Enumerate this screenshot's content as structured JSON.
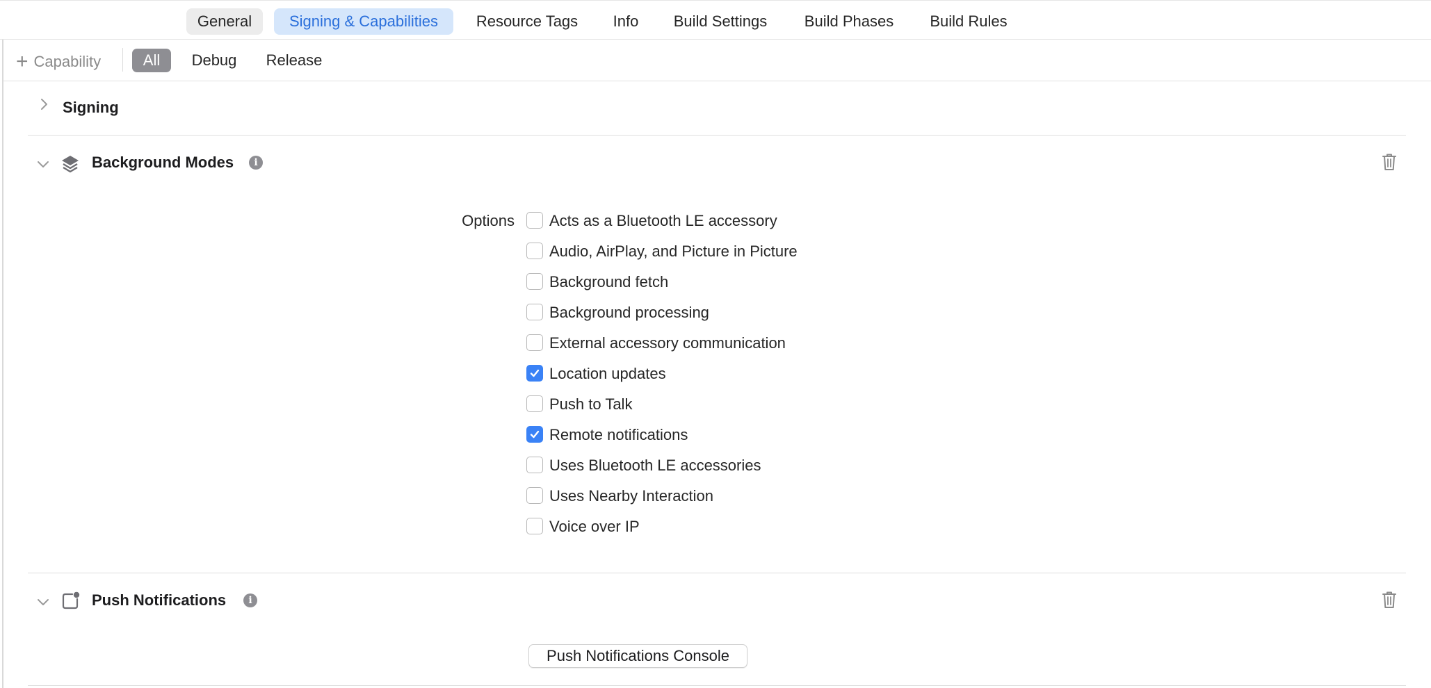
{
  "tabs": {
    "general": "General",
    "signing": "Signing & Capabilities",
    "resource_tags": "Resource Tags",
    "info": "Info",
    "build_settings": "Build Settings",
    "build_phases": "Build Phases",
    "build_rules": "Build Rules"
  },
  "filter": {
    "add_capability": "Capability",
    "all": "All",
    "debug": "Debug",
    "release": "Release"
  },
  "sections": {
    "signing": {
      "title": "Signing",
      "expanded": false
    },
    "background_modes": {
      "title": "Background Modes",
      "options_label": "Options",
      "options": [
        {
          "label": "Acts as a Bluetooth LE accessory",
          "checked": false
        },
        {
          "label": "Audio, AirPlay, and Picture in Picture",
          "checked": false
        },
        {
          "label": "Background fetch",
          "checked": false
        },
        {
          "label": "Background processing",
          "checked": false
        },
        {
          "label": "External accessory communication",
          "checked": false
        },
        {
          "label": "Location updates",
          "checked": true
        },
        {
          "label": "Push to Talk",
          "checked": false
        },
        {
          "label": "Remote notifications",
          "checked": true
        },
        {
          "label": "Uses Bluetooth LE accessories",
          "checked": false
        },
        {
          "label": "Uses Nearby Interaction",
          "checked": false
        },
        {
          "label": "Voice over IP",
          "checked": false
        }
      ]
    },
    "push_notifications": {
      "title": "Push Notifications",
      "console_button": "Push Notifications Console"
    }
  },
  "colors": {
    "accent": "#3a82f6",
    "selected_tab_bg": "#d5e6fb",
    "selected_tab_text": "#2a6fdb",
    "active_pill_bg": "#8e8e93"
  },
  "icons": {
    "plus": "plus-icon",
    "chevron_right": "chevron-right-icon",
    "chevron_down": "chevron-down-icon",
    "layers": "layers-icon",
    "notification": "notification-badge-icon",
    "info": "info-icon",
    "trash": "trash-icon",
    "checkmark": "checkmark-icon"
  }
}
